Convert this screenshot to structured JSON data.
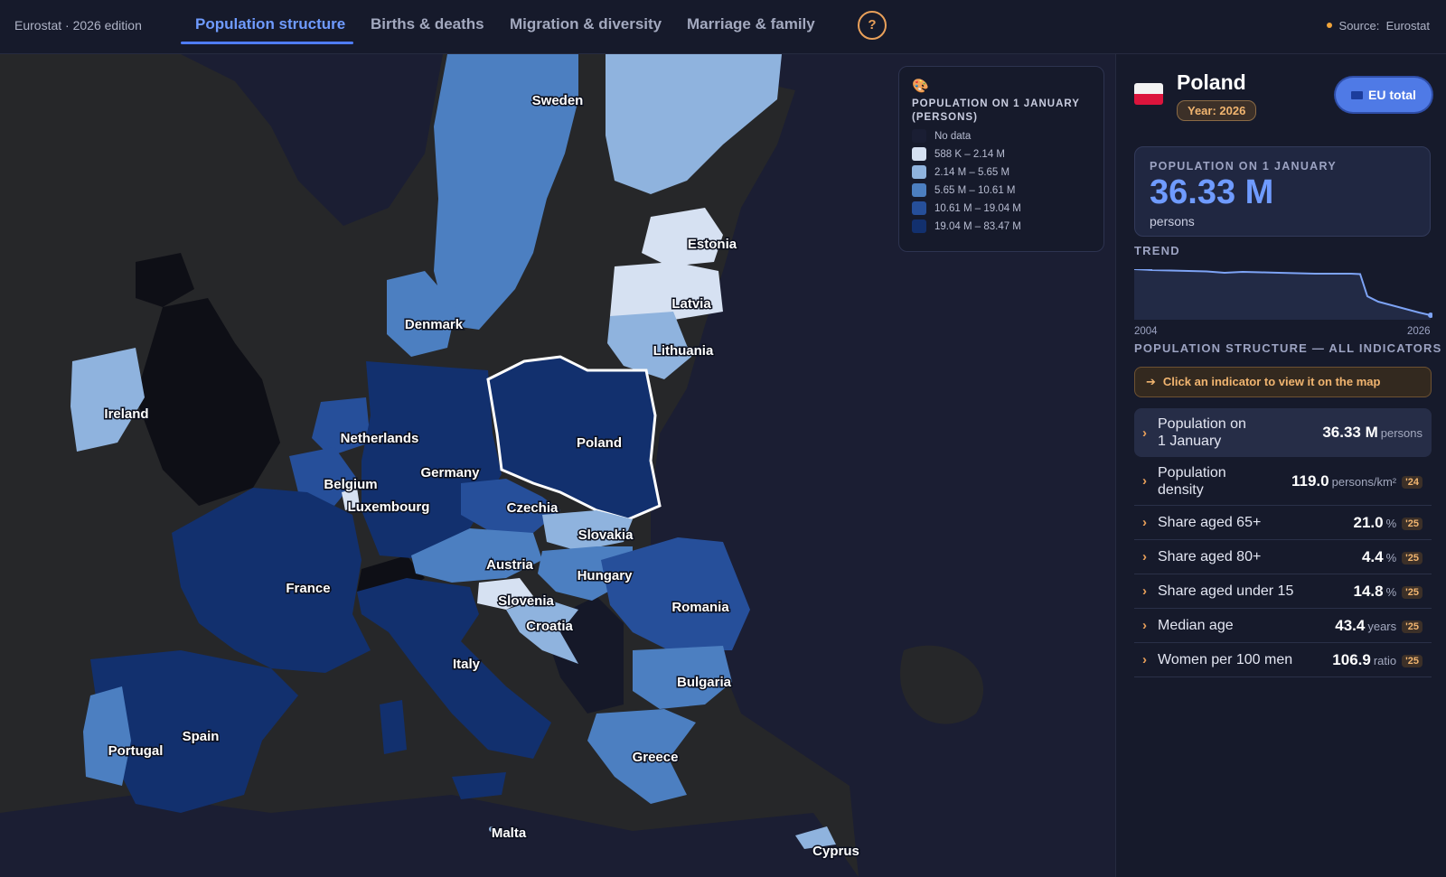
{
  "header": {
    "brand": "Eurostat · 2026 edition",
    "tabs": [
      {
        "label": "Population structure",
        "active": true
      },
      {
        "label": "Births & deaths",
        "active": false
      },
      {
        "label": "Migration & diversity",
        "active": false
      },
      {
        "label": "Marriage & family",
        "active": false
      }
    ],
    "help_label": "?",
    "source_label": "Source:",
    "source_value": "Eurostat"
  },
  "legend": {
    "icon": "palette-icon",
    "title": "POPULATION ON 1 JANUARY (PERSONS)",
    "items": [
      {
        "label": "No data",
        "color": "#1a1e33"
      },
      {
        "label": "588 K – 2.14 M",
        "color": "#d6e1f2"
      },
      {
        "label": "2.14 M – 5.65 M",
        "color": "#8fb3de"
      },
      {
        "label": "5.65 M – 10.61 M",
        "color": "#4c7fc1"
      },
      {
        "label": "10.61 M – 19.04 M",
        "color": "#264f9a"
      },
      {
        "label": "19.04 M – 83.47 M",
        "color": "#12306e"
      }
    ]
  },
  "map": {
    "selected": "Poland",
    "labels": [
      "Sweden",
      "Estonia",
      "Latvia",
      "Lithuania",
      "Denmark",
      "Ireland",
      "Netherlands",
      "Belgium",
      "Luxembourg",
      "Germany",
      "Poland",
      "Czechia",
      "Slovakia",
      "Austria",
      "Hungary",
      "Slovenia",
      "Croatia",
      "Romania",
      "France",
      "Italy",
      "Bulgaria",
      "Spain",
      "Portugal",
      "Greece",
      "Malta",
      "Cyprus"
    ]
  },
  "panel": {
    "country": "Poland",
    "year_badge": "Year: 2026",
    "eu_button": "EU total",
    "kpi": {
      "label": "POPULATION ON 1 JANUARY",
      "value": "36.33 M",
      "unit": "persons"
    },
    "trend_title": "TREND",
    "trend": {
      "start": "2004",
      "end": "2026"
    },
    "indicators_title": "POPULATION STRUCTURE — ALL INDICATORS",
    "hint": "Click an indicator to view it on the map",
    "indicators": [
      {
        "name": "Population on 1 January",
        "value": "36.33 M",
        "unit": "persons",
        "year": ""
      },
      {
        "name": "Population density",
        "value": "119.0",
        "unit": "persons/km²",
        "year": "'24"
      },
      {
        "name": "Share aged 65+",
        "value": "21.0",
        "unit": "%",
        "year": "'25"
      },
      {
        "name": "Share aged 80+",
        "value": "4.4",
        "unit": "%",
        "year": "'25"
      },
      {
        "name": "Share aged under 15",
        "value": "14.8",
        "unit": "%",
        "year": "'25"
      },
      {
        "name": "Median age",
        "value": "43.4",
        "unit": "years",
        "year": "'25"
      },
      {
        "name": "Women per 100 men",
        "value": "106.9",
        "unit": "ratio",
        "year": "'25"
      }
    ]
  }
}
